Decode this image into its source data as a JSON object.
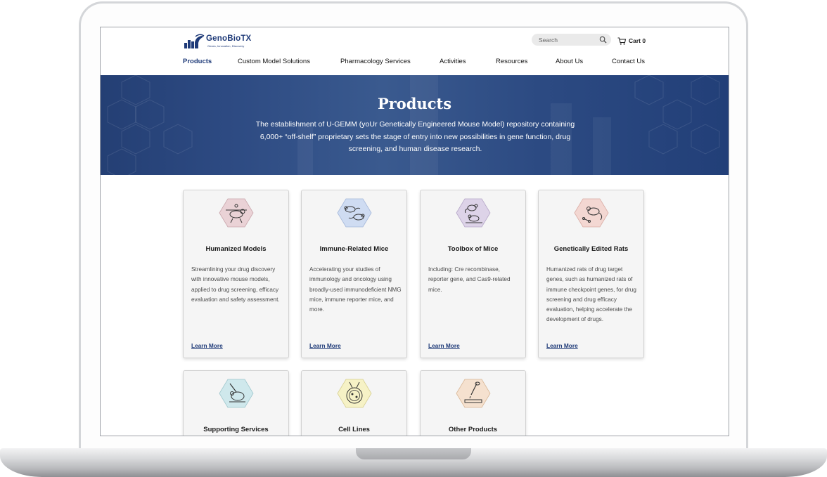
{
  "header": {
    "logo_name": "GenoBioTX",
    "logo_tagline": "Genes, Innovation, Discovery",
    "search_placeholder": "Search",
    "cart_label": "Cart 0"
  },
  "nav": {
    "items": [
      {
        "label": "Products",
        "active": true
      },
      {
        "label": "Custom Model Solutions"
      },
      {
        "label": "Pharmacology Services"
      },
      {
        "label": "Activities"
      },
      {
        "label": "Resources"
      },
      {
        "label": "About Us"
      },
      {
        "label": "Contact Us"
      }
    ]
  },
  "banner": {
    "title": "Products",
    "text": "The establishment of U-GEMM (yoUr Genetically Engineered Mouse Model) repository containing 6,000+ “off-shelf” proprietary sets the stage of entry into new possibilities in gene function, drug screening, and human disease research."
  },
  "cards": [
    {
      "title": "Humanized Models",
      "description": "Streamlining your drug discovery with innovative mouse models, applied to drug screening, efficacy evaluation and safety assessment.",
      "link": "Learn More",
      "icon": "humanized-mouse-icon",
      "color": "#ead2d6"
    },
    {
      "title": "Immune-Related Mice",
      "description": "Accelerating your studies of immunology and oncology using broadly-used immunodeficient NMG mice, immune reporter mice, and more.",
      "link": "Learn More",
      "icon": "immune-mice-icon",
      "color": "#cfdcf2"
    },
    {
      "title": "Toolbox of Mice",
      "description": "Including: Cre recombinase, reporter gene, and Cas9-related mice.",
      "link": "Learn More",
      "icon": "toolbox-mice-icon",
      "color": "#ddd3e8"
    },
    {
      "title": "Genetically Edited Rats",
      "description": "Humanized rats of drug target genes, such as humanized rats of immune checkpoint genes, for drug screening and drug efficacy evaluation, helping accelerate the development of drugs.",
      "link": "Learn More",
      "icon": "edited-rat-icon",
      "color": "#f3d7d2"
    },
    {
      "title": "Supporting Services",
      "icon": "supporting-services-icon",
      "color": "#cfe8ec"
    },
    {
      "title": "Cell Lines",
      "icon": "cell-lines-icon",
      "color": "#f6f2c6"
    },
    {
      "title": "Other Products",
      "icon": "other-products-icon",
      "color": "#f5e1cf"
    }
  ]
}
